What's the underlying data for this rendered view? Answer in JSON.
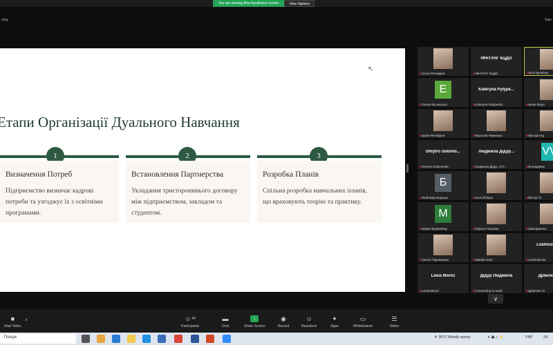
{
  "topbar": {
    "share_message": "You are viewing Віта Бугайчук's screen",
    "view_options": "View Options",
    "left_label": "ding",
    "right_label": "Sign"
  },
  "slide": {
    "title": "Етапи Організації Дуального Навчання",
    "steps": [
      {
        "number": "1",
        "title": "Визначення Потреб",
        "text": "Підприємство визначає кадрові потреби та узгоджує їх з освітніми програмами."
      },
      {
        "number": "2",
        "title": "Встановлення Партнерства",
        "text": "Укладання тристоронннього договору між підприємством, закладом та студентом."
      },
      {
        "number": "3",
        "title": "Розробка Планів",
        "text": "Спільна розробка навчальних планів, що враховують теорію та практику."
      }
    ]
  },
  "gallery": {
    "tiles": [
      {
        "type": "photo",
        "caption": "Ілона Регейдіна"
      },
      {
        "type": "name",
        "name": "ІФНТУНГ КЦДО",
        "caption": "ІФНТУНГ КЦДО"
      },
      {
        "type": "photo",
        "caption": "Віта Бугайчук",
        "active": true
      },
      {
        "type": "letter",
        "letter": "Е",
        "color": "#5aa83a",
        "caption": "Олена Бучинська"
      },
      {
        "type": "name",
        "name": "Kateryna Pylype...",
        "caption": "Kateryna Pylypenko"
      },
      {
        "type": "photo",
        "caption": "Ірина Федо"
      },
      {
        "type": "photo",
        "caption": "Ірина Регейдіна"
      },
      {
        "type": "photo",
        "caption": "Ярослав Якименко"
      },
      {
        "type": "photo",
        "caption": "Вікторія Кр"
      },
      {
        "type": "name",
        "name": "Dmytro Solomo...",
        "caption": "Dmytro Solomonka"
      },
      {
        "type": "name",
        "name": "Людмила Дідур...",
        "caption": "Людмила Дідур, ОН..."
      },
      {
        "type": "letter",
        "letter": "VV",
        "color": "#1fb7b0",
        "caption": "Володимир"
      },
      {
        "type": "letter",
        "letter": "Б",
        "color": "#555d66",
        "caption": "Любомир Боруцьк"
      },
      {
        "type": "photo",
        "caption": "Інна Ліберко"
      },
      {
        "type": "photo",
        "caption": "Віктор Га"
      },
      {
        "type": "letter",
        "letter": "М",
        "color": "#2e7d3a",
        "caption": "Марія Фурманець"
      },
      {
        "type": "photo",
        "caption": "Лариса Петрова"
      },
      {
        "type": "photo",
        "caption": "Шапорвенко"
      },
      {
        "type": "photo",
        "caption": "Олеся Тарнавська"
      },
      {
        "type": "photo",
        "caption": "Natalia Oran"
      },
      {
        "type": "name",
        "name": "Liudmula N...",
        "caption": "Liudmula Na"
      },
      {
        "type": "name",
        "name": "Lesia Moroz",
        "caption": "Lesia Moroz"
      },
      {
        "type": "name",
        "name": "Дідур Людмила",
        "caption": "Connecting to audio"
      },
      {
        "type": "name",
        "name": "Дрімлюх ...",
        "caption": "Дрімлюх Ні"
      }
    ],
    "more_icon": "chevron-down-icon"
  },
  "toolbar": {
    "buttons": [
      {
        "label": "Start Video",
        "icon": "video-icon"
      },
      {
        "label": "Participants",
        "icon": "participants-icon",
        "count": "40"
      },
      {
        "label": "Chat",
        "icon": "chat-icon"
      },
      {
        "label": "Share Screen",
        "icon": "share-screen-icon"
      },
      {
        "label": "Record",
        "icon": "record-icon"
      },
      {
        "label": "Reactions",
        "icon": "reactions-icon"
      },
      {
        "label": "Apps",
        "icon": "apps-icon"
      },
      {
        "label": "Whiteboards",
        "icon": "whiteboard-icon"
      },
      {
        "label": "Notes",
        "icon": "notes-icon"
      }
    ]
  },
  "taskbar": {
    "search_placeholder": "Пошук",
    "weather": "30°C",
    "weather_text": "Mostly sunny",
    "lang": "УКР",
    "time": "24"
  },
  "colors": {
    "accent_green": "#2e5a43",
    "zoom_green": "#23a454",
    "card_bg": "#faf6f2"
  }
}
